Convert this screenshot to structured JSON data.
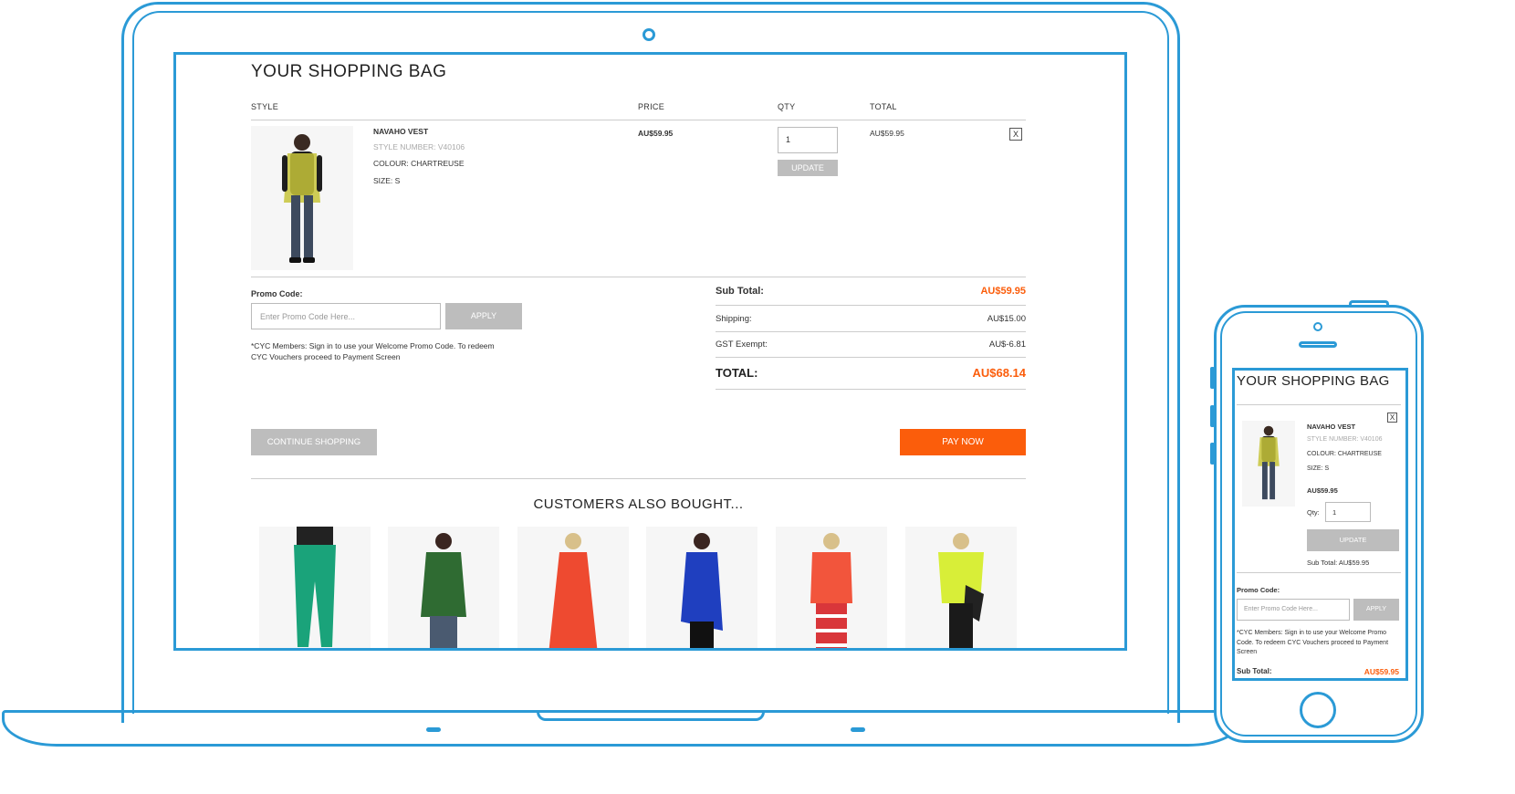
{
  "bag": {
    "title": "YOUR SHOPPING BAG",
    "columns": {
      "style": "STYLE",
      "price": "PRICE",
      "qty": "QTY",
      "total": "TOTAL"
    },
    "item": {
      "name": "NAVAHO VEST",
      "style_number": "STYLE NUMBER: V40106",
      "colour": "COLOUR: CHARTREUSE",
      "size": "SIZE: S",
      "price": "AU$59.95",
      "qty": "1",
      "total": "AU$59.95",
      "update_label": "UPDATE",
      "remove_label": "X"
    },
    "promo": {
      "label": "Promo Code:",
      "placeholder": "Enter Promo Code Here...",
      "apply_label": "APPLY",
      "note": "*CYC Members: Sign in to use your Welcome Promo Code. To redeem CYC Vouchers proceed to Payment Screen"
    },
    "summary": {
      "subtotal_label": "Sub Total:",
      "subtotal": "AU$59.95",
      "shipping_label": "Shipping:",
      "shipping": "AU$15.00",
      "gst_label": "GST Exempt:",
      "gst": "AU$-6.81",
      "total_label": "TOTAL:",
      "total": "AU$68.14"
    },
    "continue_label": "CONTINUE SHOPPING",
    "pay_label": "PAY NOW",
    "also_bought_title": "CUSTOMERS ALSO BOUGHT..."
  },
  "mobile": {
    "title": "YOUR SHOPPING BAG",
    "item_name": "NAVAHO VEST",
    "style_number": "STYLE NUMBER: V40106",
    "colour": "COLOUR: CHARTREUSE",
    "size": "SIZE: S",
    "price": "AU$59.95",
    "qty_label": "Qty:",
    "qty": "1",
    "update_label": "UPDATE",
    "subtotal_line": "Sub Total: AU$59.95",
    "promo_label": "Promo Code:",
    "promo_placeholder": "Enter Promo Code Here...",
    "apply_label": "APPLY",
    "note": "*CYC Members: Sign in to use your Welcome Promo Code. To redeem CYC Vouchers proceed to Payment Screen",
    "subtotal_label": "Sub Total:",
    "subtotal": "AU$59.95",
    "remove_label": "X"
  },
  "colors": {
    "frame": "#2b9ad6",
    "accent": "#fb5d0b",
    "button_grey": "#bdbdbd"
  }
}
